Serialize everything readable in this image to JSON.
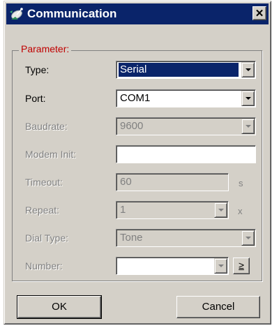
{
  "window": {
    "title": "Communication",
    "close_glyph": "✕"
  },
  "icons": {
    "app": "satellite-dish-icon",
    "close": "close-icon",
    "dropdown": "chevron-down-icon"
  },
  "group": {
    "title": "Parameter:"
  },
  "fields": {
    "type": {
      "label": "Type:",
      "value": "Serial",
      "enabled": true,
      "selected": true
    },
    "port": {
      "label": "Port:",
      "value": "COM1",
      "enabled": true
    },
    "baudrate": {
      "label": "Baudrate:",
      "value": "9600",
      "enabled": false
    },
    "modem_init": {
      "label": "Modem Init:",
      "value": "",
      "enabled": true
    },
    "timeout": {
      "label": "Timeout:",
      "value": "60",
      "unit": "s",
      "enabled": false
    },
    "repeat": {
      "label": "Repeat:",
      "value": "1",
      "unit": "x",
      "enabled": false
    },
    "dial_type": {
      "label": "Dial Type:",
      "value": "Tone",
      "enabled": false
    },
    "number": {
      "label": "Number:",
      "value": "",
      "enabled": false,
      "dial_button_label": "≥"
    }
  },
  "buttons": {
    "ok": "OK",
    "cancel": "Cancel"
  },
  "colors": {
    "titlebar": "#0a246a",
    "face": "#d4d0c8",
    "group_title": "#c00000",
    "disabled_text": "#808080"
  }
}
